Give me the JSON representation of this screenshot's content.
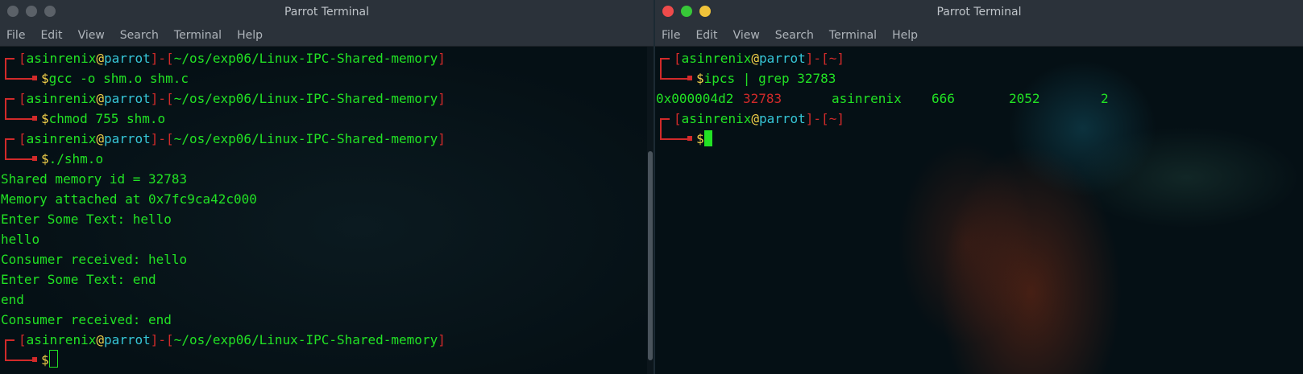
{
  "left": {
    "title": "Parrot Terminal",
    "menu": [
      "File",
      "Edit",
      "View",
      "Search",
      "Terminal",
      "Help"
    ],
    "prompt_user": "asinrenix",
    "prompt_host": "parrot",
    "prompt_path": "~/os/exp06/Linux-IPC-Shared-memory",
    "cmd1": "gcc -o shm.o shm.c",
    "cmd2": "chmod 755 shm.o",
    "cmd3": "./shm.o",
    "output": [
      "Shared memory id = 32783",
      "Memory attached at 0x7fc9ca42c000",
      "Enter Some Text: hello",
      "hello",
      "Consumer received: hello",
      "Enter Some Text: end",
      "end",
      "Consumer received: end"
    ]
  },
  "right": {
    "title": "Parrot Terminal",
    "menu": [
      "File",
      "Edit",
      "View",
      "Search",
      "Terminal",
      "Help"
    ],
    "prompt_user": "asinrenix",
    "prompt_host": "parrot",
    "prompt_path": "~",
    "cmd1": "ipcs | grep 32783",
    "ipcs_row": {
      "key": "0x000004d2",
      "shmid": "32783",
      "owner": "asinrenix",
      "perms": "666",
      "bytes": "2052",
      "nattch": "2"
    }
  },
  "colors": {
    "green": "#22e224",
    "red": "#d12a2a",
    "yellow": "#f2d14a",
    "cyan": "#36c5d6"
  },
  "icons": [
    "close-dot-icon",
    "minimize-dot-icon",
    "maximize-dot-icon"
  ]
}
